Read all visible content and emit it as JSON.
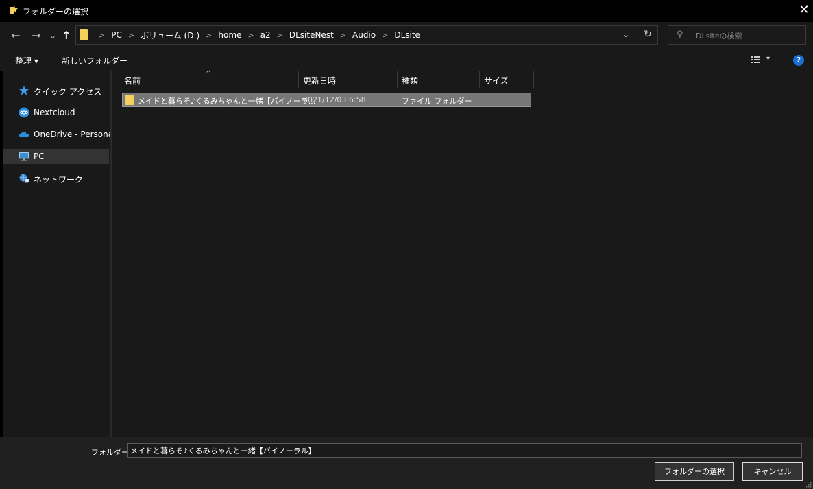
{
  "window": {
    "title": "フォルダーの選択",
    "close_glyph": "✕"
  },
  "nav": {
    "back_glyph": "←",
    "forward_glyph": "→",
    "recent_glyph": "⌄",
    "up_glyph": "↑",
    "breadcrumbs": [
      "PC",
      "ボリューム (D:)",
      "home",
      "a2",
      "DLsiteNest",
      "Audio",
      "DLsite"
    ],
    "breadcrumb_sep": ">",
    "dropdown_glyph": "⌄",
    "refresh_glyph": "↻",
    "search_placeholder": "DLsiteの検索",
    "search_icon_glyph": "⚲"
  },
  "toolbar": {
    "organize_label": "整理 ▾",
    "new_folder_label": "新しいフォルダー",
    "help_glyph": "?",
    "view_drop_glyph": "▾"
  },
  "sidebar": {
    "items": [
      {
        "label": "クイック アクセス",
        "icon": "star-icon"
      },
      {
        "label": "Nextcloud",
        "icon": "nextcloud-icon"
      },
      {
        "label": "OneDrive - Personal",
        "icon": "cloud-icon"
      },
      {
        "label": "PC",
        "icon": "computer-icon",
        "selected": true
      },
      {
        "label": "ネットワーク",
        "icon": "network-icon"
      }
    ]
  },
  "list": {
    "columns": [
      "名前",
      "更新日時",
      "種類",
      "サイズ"
    ],
    "sort_glyph": "^",
    "rows": [
      {
        "name": "メイドと暮らそ♪くるみちゃんと一緒【バイノーラ...",
        "modified": "2021/12/03 6:58",
        "type": "ファイル フォルダー",
        "size": ""
      }
    ]
  },
  "footer": {
    "folder_label": "フォルダー:",
    "folder_value": "メイドと暮らそ♪くるみちゃんと一緒【バイノーラル】",
    "select_button": "フォルダーの選択",
    "cancel_button": "キャンセル"
  },
  "colors": {
    "folder": "#f4cf5b",
    "accent_blue": "#1a6fd0",
    "selection": "#777777"
  }
}
